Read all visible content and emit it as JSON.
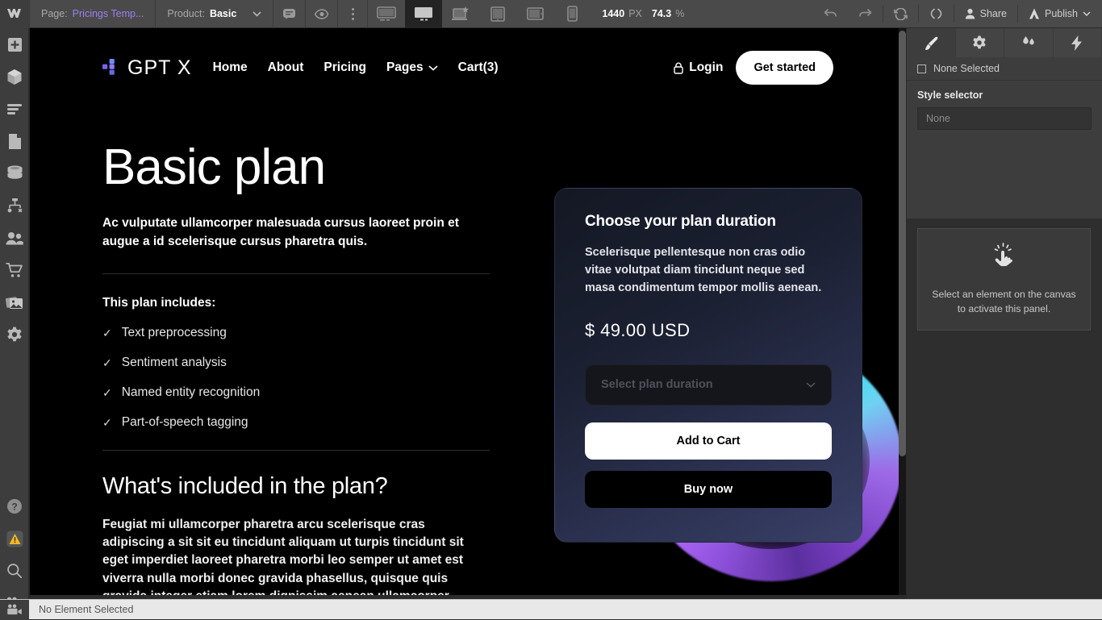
{
  "topbar": {
    "logo": "W",
    "page_label": "Page:",
    "page_value": "Pricings Temp...",
    "product_label": "Product:",
    "product_value": "Basic",
    "comment_icon": "comment-icon",
    "preview_icon": "eye-icon",
    "kebab_icon": "more-options-icon",
    "breakpoints": [
      {
        "name": "breakpoint-large",
        "icon": "monitor-large-icon",
        "active": false
      },
      {
        "name": "breakpoint-desktop",
        "icon": "monitor-icon",
        "active": true
      },
      {
        "name": "breakpoint-laptop",
        "icon": "laptop-star-icon",
        "active": false
      },
      {
        "name": "breakpoint-tablet",
        "icon": "tablet-portrait-icon",
        "active": false
      },
      {
        "name": "breakpoint-tablet-landscape",
        "icon": "tablet-landscape-icon",
        "active": false
      },
      {
        "name": "breakpoint-mobile",
        "icon": "mobile-icon",
        "active": false
      }
    ],
    "canvas_width": "1440",
    "canvas_unit": "PX",
    "zoom_value": "74.3",
    "zoom_unit": "%",
    "undo_icon": "undo-icon",
    "redo_icon": "redo-icon",
    "sync_icon": "refresh-icon",
    "code_icon": "code-icon",
    "share_label": "Share",
    "publish_label": "Publish"
  },
  "sidebar": {
    "items": [
      {
        "name": "add-elements",
        "icon": "plus-box-icon"
      },
      {
        "name": "components",
        "icon": "cube-icon"
      },
      {
        "name": "navigator",
        "icon": "navigator-icon"
      },
      {
        "name": "pages",
        "icon": "page-icon"
      },
      {
        "name": "cms",
        "icon": "database-icon"
      },
      {
        "name": "logic",
        "icon": "flow-icon"
      },
      {
        "name": "users",
        "icon": "users-icon"
      },
      {
        "name": "ecommerce",
        "icon": "cart-icon"
      },
      {
        "name": "assets",
        "icon": "images-icon"
      },
      {
        "name": "settings",
        "icon": "gear-icon"
      }
    ],
    "bottom_items": [
      {
        "name": "help",
        "icon": "question-circle-icon"
      },
      {
        "name": "audit",
        "icon": "warning-triangle-icon"
      },
      {
        "name": "search",
        "icon": "magnifier-icon"
      },
      {
        "name": "video",
        "icon": "video-camera-icon"
      }
    ]
  },
  "site": {
    "brand": "GPT X",
    "logo_icon": "gptx-logo-icon",
    "nav": [
      {
        "label": "Home"
      },
      {
        "label": "About"
      },
      {
        "label": "Pricing"
      },
      {
        "label": "Pages",
        "has_dropdown": true
      },
      {
        "label": "Cart(3)"
      }
    ],
    "login_label": "Login",
    "login_icon": "lock-icon",
    "get_started_label": "Get started",
    "hero": {
      "title": "Basic plan",
      "lead": "Ac vulputate ullamcorper malesuada cursus laoreet proin et augue a id scelerisque cursus pharetra quis.",
      "includes_title": "This plan includes:",
      "features": [
        "Text preprocessing",
        "Sentiment analysis",
        "Named entity recognition",
        "Part-of-speech tagging"
      ],
      "section_title": "What's included in the plan?",
      "body": "Feugiat mi ullamcorper pharetra arcu scelerisque cras adipiscing a sit sit eu tincidunt aliquam ut turpis tincidunt sit eget imperdiet laoreet pharetra morbi leo semper ut amet est viverra nulla morbi donec gravida phasellus, quisque quis gravida integer etiam lorem dignissim aenean ullamcorper senectus lobortis sed gravida libero viverra aenean velit."
    },
    "card": {
      "title": "Choose your plan duration",
      "description": "Scelerisque pellentesque non cras odio vitae volutpat diam tincidunt neque sed masa condimentum tempor mollis aenean.",
      "price": "$ 49.00 USD",
      "select_placeholder": "Select plan duration",
      "select_chevron": "chevron-down-icon",
      "add_to_cart_label": "Add to Cart",
      "buy_now_label": "Buy now"
    }
  },
  "right_panel": {
    "tabs": [
      {
        "name": "style",
        "icon": "brush-icon",
        "active": true
      },
      {
        "name": "settings",
        "icon": "gear-icon",
        "active": false
      },
      {
        "name": "style-manager",
        "icon": "drops-icon",
        "active": false
      },
      {
        "name": "interactions",
        "icon": "lightning-icon",
        "active": false
      }
    ],
    "selection_label": "None Selected",
    "style_selector_label": "Style selector",
    "style_selector_value": "None",
    "empty_icon": "pointing-hand-icon",
    "empty_message": "Select an element on the canvas to activate this panel."
  },
  "status_bar": {
    "icon": "video-camera-icon",
    "text": "No Element Selected"
  },
  "colors": {
    "accent_purple": "#9b7ff0",
    "chrome_bg": "#3d3d3d",
    "topbar_bg": "#4a4a4a",
    "canvas_bg": "#000000",
    "status_bg": "#e8e8e8"
  }
}
